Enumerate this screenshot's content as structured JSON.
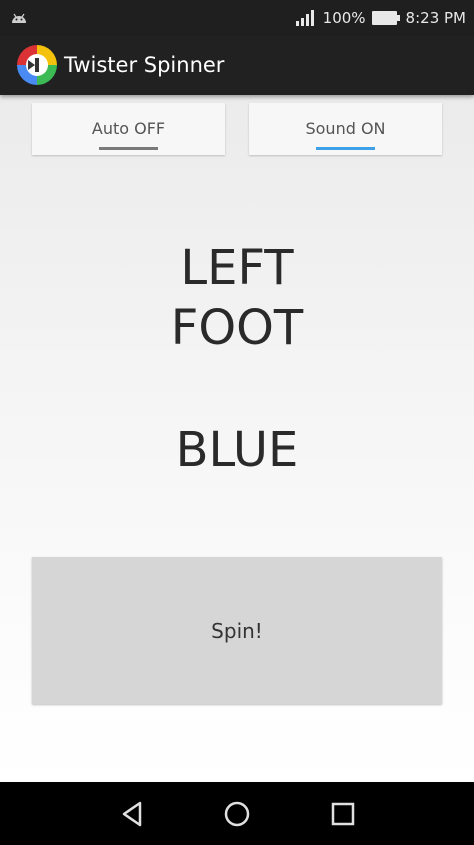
{
  "status_bar": {
    "battery": "100%",
    "time": "8:23 PM",
    "icons": [
      "android-notification-icon",
      "signal-icon",
      "battery-icon"
    ]
  },
  "app_bar": {
    "title": "Twister Spinner",
    "icon": "spinner-logo-icon"
  },
  "toggles": {
    "auto_label": "Auto OFF",
    "sound_label": "Sound ON"
  },
  "result": {
    "line1": "LEFT",
    "line2": "FOOT",
    "color": "BLUE"
  },
  "spin_button": {
    "label": "Spin!"
  },
  "nav_bar": {
    "icons": [
      "back-icon",
      "home-icon",
      "recents-icon"
    ]
  },
  "colors": {
    "bar_dark": "#212121",
    "indicator_on": "#3ea0e6",
    "indicator_off": "#7a7a7a",
    "spin_button_bg": "#d6d6d6"
  }
}
